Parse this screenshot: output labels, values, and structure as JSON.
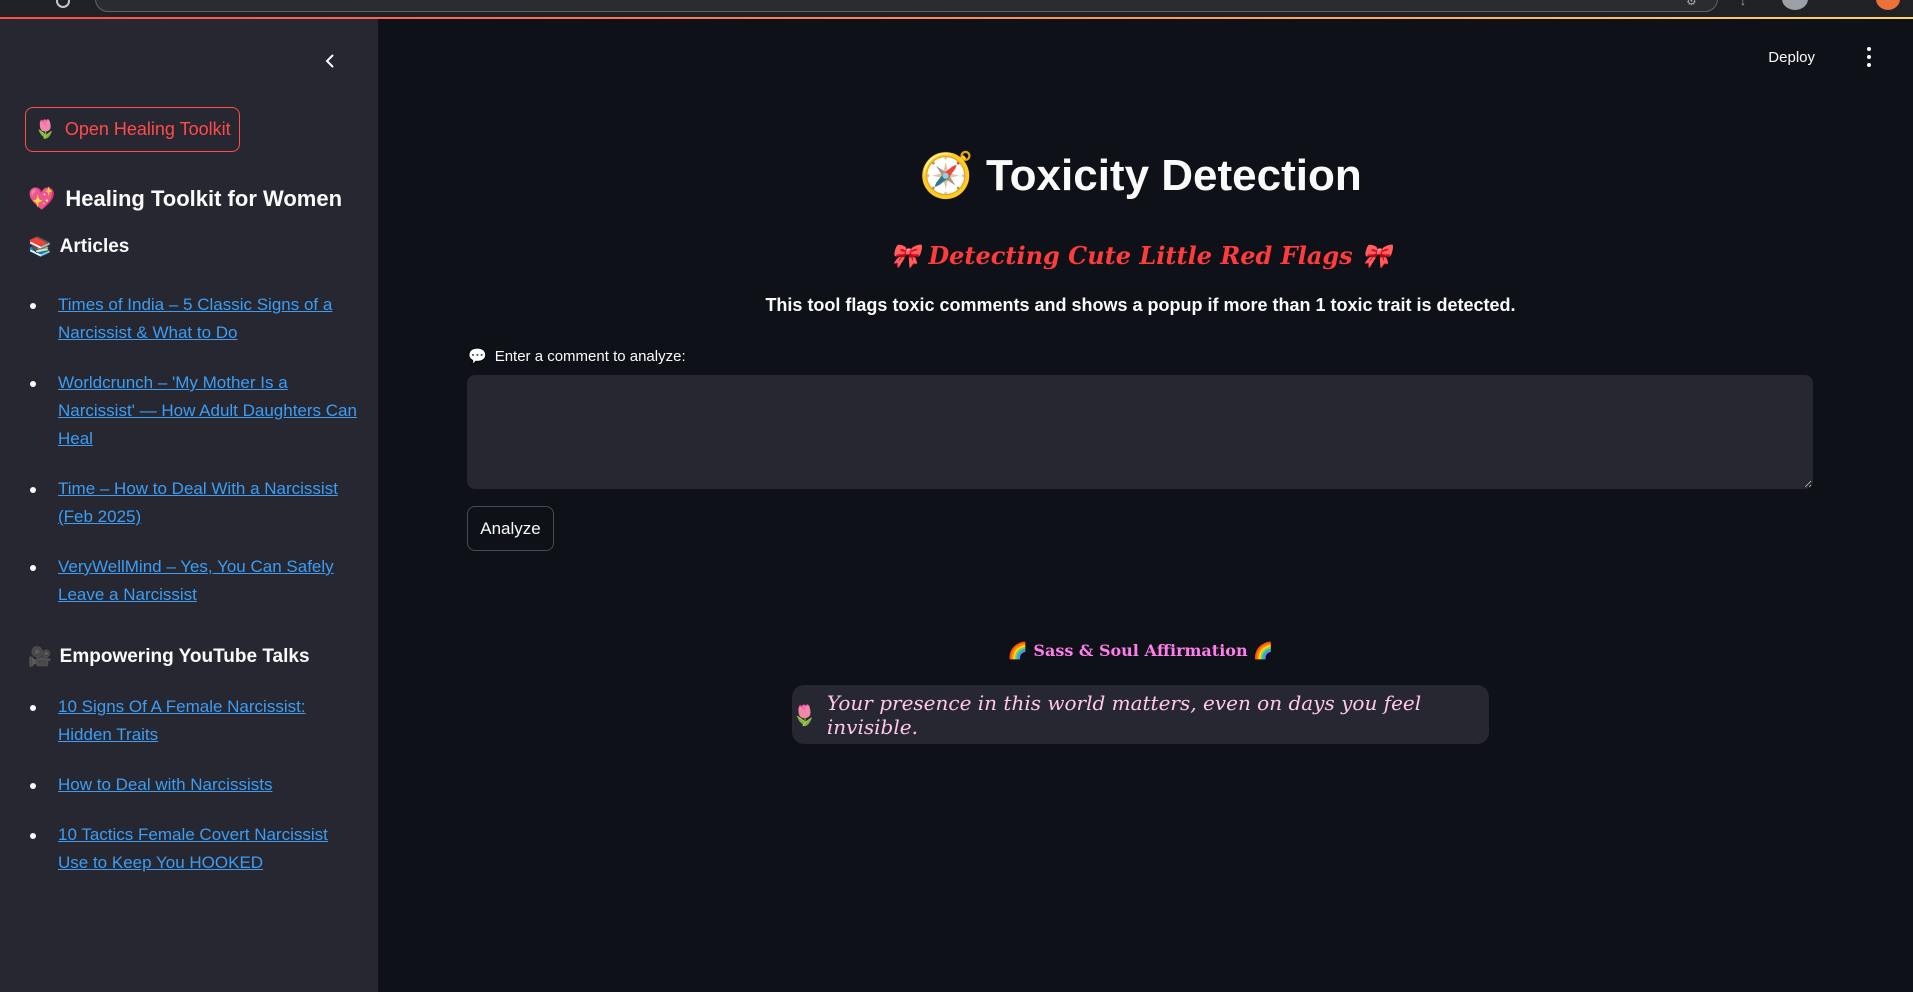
{
  "sidebar": {
    "collapse_label": "‹",
    "toolkit_button": {
      "icon": "🌷",
      "label": "Open Healing Toolkit"
    },
    "heading": {
      "icon": "💖",
      "text": "Healing Toolkit for Women"
    },
    "articles": {
      "icon": "📚",
      "heading": "Articles",
      "items": [
        {
          "label": "Times of India – 5 Classic Signs of a Narcissist & What to Do"
        },
        {
          "label": "Worldcrunch – 'My Mother Is a Narcissist' — How Adult Daughters Can Heal"
        },
        {
          "label": "Time – How to Deal With a Narcissist (Feb 2025)"
        },
        {
          "label": "VeryWellMind – Yes, You Can Safely Leave a Narcissist"
        }
      ]
    },
    "youtube": {
      "icon": "🎥",
      "heading": "Empowering YouTube Talks",
      "items": [
        {
          "label": "10 Signs Of A Female Narcissist: Hidden Traits"
        },
        {
          "label": "How to Deal with Narcissists"
        },
        {
          "label": "10 Tactics Female Covert Narcissist Use to Keep You HOOKED"
        }
      ]
    }
  },
  "header": {
    "deploy_label": "Deploy"
  },
  "main": {
    "title_icon": "🧭",
    "title": "Toxicity Detection",
    "subtitle": "🎀 Detecting Cute Little Red Flags 🎀",
    "description": "This tool flags toxic comments and shows a popup if more than 1 toxic trait is detected.",
    "input_label_icon": "💬",
    "input_label": "Enter a comment to analyze:",
    "input_value": "",
    "analyze_label": "Analyze",
    "affirmation_title": "🌈 Sass & Soul Affirmation 🌈",
    "affirmation_icon": "🌷",
    "affirmation_text": "Your presence in this world matters, even on days you feel invisible."
  },
  "colors": {
    "accent": "#ff4b4b",
    "link": "#3d9df3",
    "subtitle": "#ff3b3b",
    "affirmation_title": "#ff7eea",
    "background": "#0e1117",
    "sidebar": "#262730"
  }
}
